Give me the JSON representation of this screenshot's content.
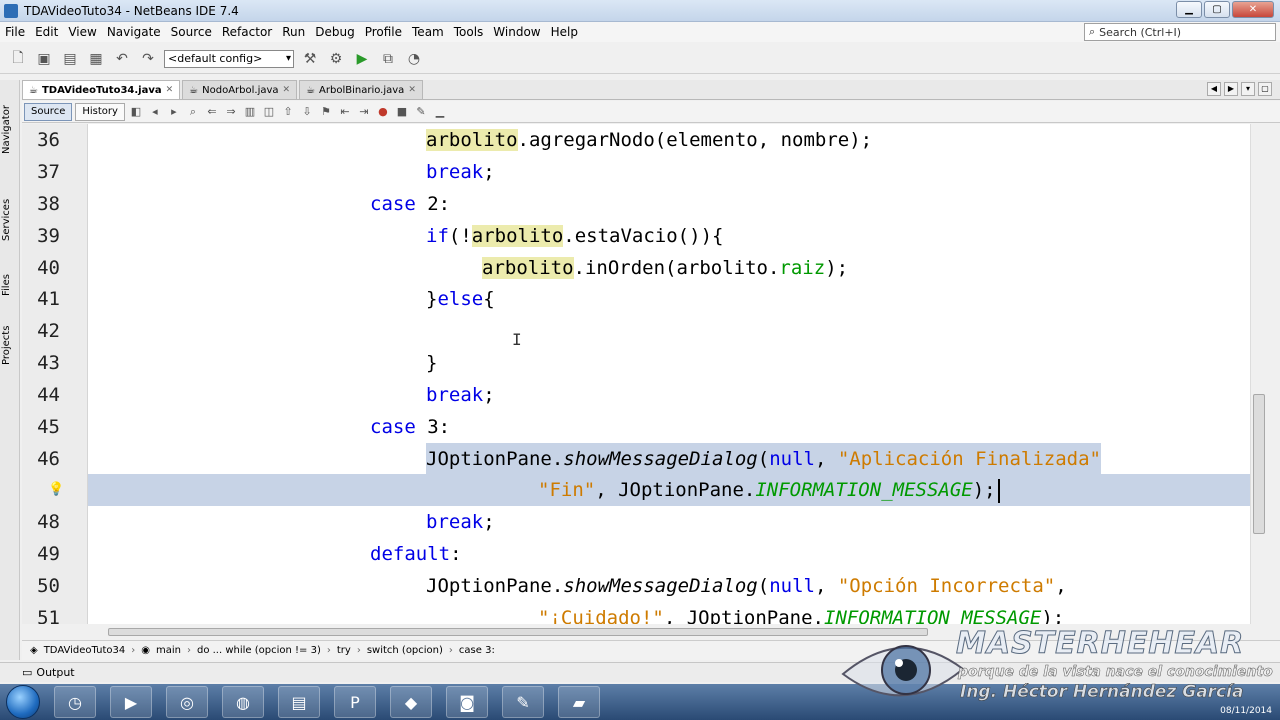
{
  "window": {
    "title": "TDAVideoTuto34 - NetBeans IDE 7.4",
    "minimize": "▁",
    "maximize": "▢",
    "close": "✕"
  },
  "menu": [
    "File",
    "Edit",
    "View",
    "Navigate",
    "Source",
    "Refactor",
    "Run",
    "Debug",
    "Profile",
    "Team",
    "Tools",
    "Window",
    "Help"
  ],
  "search": {
    "placeholder": "Search (Ctrl+I)"
  },
  "toolbar": {
    "config": "<default config>"
  },
  "side_tabs": [
    "Navigator",
    "Services",
    "Files",
    "Projects"
  ],
  "tabs": [
    {
      "label": "TDAVideoTuto34.java",
      "active": true
    },
    {
      "label": "NodoArbol.java",
      "active": false
    },
    {
      "label": "ArbolBinario.java",
      "active": false
    }
  ],
  "editor_toolbar": {
    "source": "Source",
    "history": "History"
  },
  "lines": [
    {
      "n": "36"
    },
    {
      "n": "37"
    },
    {
      "n": "38"
    },
    {
      "n": "39"
    },
    {
      "n": "40"
    },
    {
      "n": "41"
    },
    {
      "n": "42"
    },
    {
      "n": "43"
    },
    {
      "n": "44"
    },
    {
      "n": "45"
    },
    {
      "n": "46"
    },
    {
      "n": ""
    },
    {
      "n": "48"
    },
    {
      "n": "49"
    },
    {
      "n": "50"
    },
    {
      "n": "51"
    }
  ],
  "code": {
    "l36": {
      "a": "arbolito",
      "b": ".agregarNodo(elemento, nombre);"
    },
    "l37": {
      "kw": "break",
      "b": ";"
    },
    "l38": {
      "kw": "case",
      "b": " 2:"
    },
    "l39": {
      "kw": "if",
      "a": "(!",
      "m": "arbolito",
      "b": ".estaVacio()){"
    },
    "l40": {
      "m": "arbolito",
      "b": ".inOrden(arbolito.",
      "f": "raiz",
      "c": ");"
    },
    "l41": {
      "a": "}",
      "kw": "else",
      "b": "{"
    },
    "l43": {
      "a": "}"
    },
    "l44": {
      "kw": "break",
      "b": ";"
    },
    "l45": {
      "kw": "case",
      "b": " 3:"
    },
    "l46": {
      "a": "JOptionPane.",
      "m": "showMessageDialog",
      "b": "(",
      "kw": "null",
      "c": ", ",
      "s": "\"Aplicación Finalizada\""
    },
    "l47": {
      "s": "\"Fin\"",
      "a": ", JOptionPane.",
      "f": "INFORMATION_MESSAGE",
      "b": ");"
    },
    "l48": {
      "kw": "break",
      "b": ";"
    },
    "l49": {
      "kw": "default",
      "b": ":"
    },
    "l50": {
      "a": "JOptionPane.",
      "m": "showMessageDialog",
      "b": "(",
      "kw": "null",
      "c": ", ",
      "s": "\"Opción Incorrecta\"",
      "d": ","
    },
    "l51": {
      "s": "\"¡Cuidado!\"",
      "a": ", JOptionPane.",
      "f": "INFORMATION_MESSAGE",
      "b": ");"
    }
  },
  "breadcrumb": [
    "TDAVideoTuto34",
    "main",
    "do ... while (opcion != 3)",
    "try",
    "switch (opcion)",
    "case 3:"
  ],
  "output": {
    "label": "Output"
  },
  "watermark": {
    "title": "MASTERHEHEAR",
    "subtitle": "porque de la vista nace el conocimiento",
    "author": "Ing. Héctor Hernández García"
  },
  "taskbar": {
    "clock": "08/11/2014"
  },
  "colors": {
    "keyword": "#0000e6",
    "string": "#ce7b00",
    "field": "#009900",
    "mark": "#ecebad",
    "selection": "#c7d3e6"
  }
}
